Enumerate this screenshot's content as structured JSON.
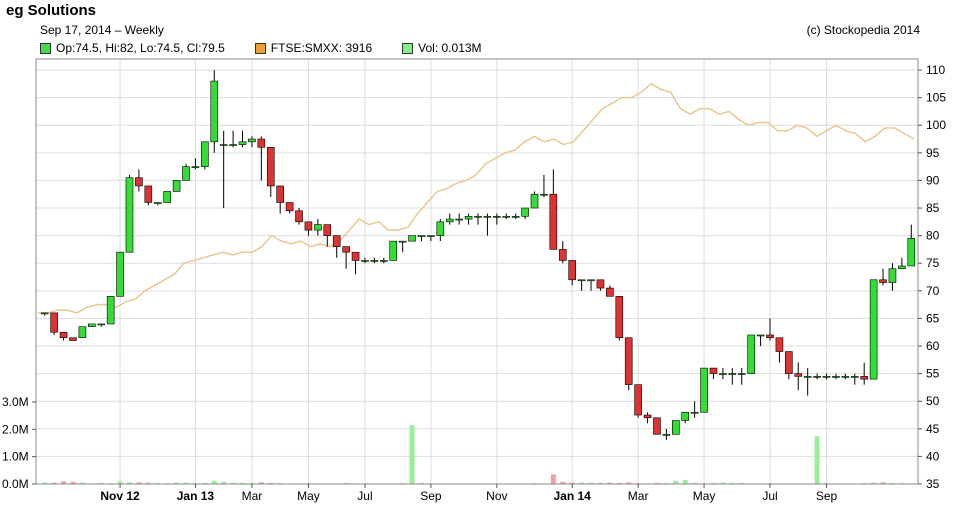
{
  "header": {
    "title": "eg Solutions",
    "subtitle": "Sep 17, 2014  – Weekly",
    "copyright": "(c) Stockopedia 2014"
  },
  "legend": [
    {
      "label": "Op:74.5, Hi:82, Lo:74.5, Cl:79.5",
      "color": "#44dd44"
    },
    {
      "label": "FTSE:SMXX: 3916",
      "color": "#f0a030"
    },
    {
      "label": "Vol: 0.013M",
      "color": "#88ee88"
    }
  ],
  "colors": {
    "up": "#33dd33",
    "down": "#dd3333",
    "index_line": "#e8c890",
    "vol_up": "#99ee99",
    "vol_down": "#f4a0a0",
    "grid": "#dddddd"
  },
  "chart_data": {
    "type": "candlestick",
    "x_ticks": [
      "Nov 12",
      "Jan 13",
      "Mar",
      "May",
      "Jul",
      "Sep",
      "Nov",
      "Jan 14",
      "Mar",
      "May",
      "Jul",
      "Sep"
    ],
    "bold_ticks": [
      "Nov 12",
      "Jan 13",
      "Jan 14"
    ],
    "y_price_ticks": [
      35,
      40,
      45,
      50,
      55,
      60,
      65,
      70,
      75,
      80,
      85,
      90,
      95,
      100,
      105,
      110
    ],
    "y_price_range": [
      35,
      112
    ],
    "y_volume_ticks": [
      "0.0M",
      "1.0M",
      "2.0M",
      "3.0M"
    ],
    "y_volume_range": [
      0,
      3
    ],
    "grid": true,
    "candles": [
      [
        66,
        66,
        65.5,
        66
      ],
      [
        66,
        66,
        62,
        62.5
      ],
      [
        62.5,
        62.5,
        61,
        61.5
      ],
      [
        61.5,
        61.5,
        61,
        61
      ],
      [
        61.5,
        63.5,
        61.5,
        63.5
      ],
      [
        63.5,
        64,
        63.5,
        64
      ],
      [
        64,
        64,
        63.5,
        64
      ],
      [
        64,
        69,
        64,
        69
      ],
      [
        69,
        77,
        69,
        77
      ],
      [
        77,
        91,
        77,
        90.5
      ],
      [
        90.5,
        92,
        88,
        89
      ],
      [
        89,
        89,
        85.5,
        86
      ],
      [
        86,
        86,
        85.5,
        86
      ],
      [
        86,
        88,
        86,
        88
      ],
      [
        88,
        90,
        88,
        90
      ],
      [
        90,
        93,
        90,
        92.5
      ],
      [
        92.5,
        94,
        92,
        92.5
      ],
      [
        92.5,
        97,
        92,
        97
      ],
      [
        97,
        110,
        95,
        108
      ],
      [
        96.5,
        99,
        85,
        96.5
      ],
      [
        96.5,
        99,
        96,
        96.5
      ],
      [
        96.5,
        99,
        96,
        97
      ],
      [
        97,
        98,
        96,
        97.5
      ],
      [
        97.5,
        98,
        90,
        96
      ],
      [
        96,
        96,
        87,
        89
      ],
      [
        89,
        89,
        84,
        86
      ],
      [
        86,
        86,
        84,
        84.5
      ],
      [
        84.5,
        85,
        82,
        82.5
      ],
      [
        82.5,
        82.5,
        80,
        81
      ],
      [
        81,
        83,
        80,
        82
      ],
      [
        82,
        82,
        78,
        80
      ],
      [
        80,
        80,
        76,
        78
      ],
      [
        78,
        78,
        74,
        77
      ],
      [
        77,
        77,
        73,
        75.5
      ],
      [
        75.5,
        76,
        75,
        75.5
      ],
      [
        75.5,
        76,
        75,
        75.5
      ],
      [
        75.5,
        76,
        75,
        75.5
      ],
      [
        75.5,
        79,
        75.5,
        79
      ],
      [
        79,
        79,
        77,
        79
      ],
      [
        79,
        80,
        79,
        80
      ],
      [
        80,
        80,
        79,
        80
      ],
      [
        80,
        80,
        79,
        80
      ],
      [
        80,
        83,
        79,
        82.5
      ],
      [
        82.5,
        84,
        82,
        83
      ],
      [
        83,
        84,
        82,
        83
      ],
      [
        83,
        84,
        82,
        83.5
      ],
      [
        83.5,
        84,
        82,
        83.5
      ],
      [
        83.5,
        84,
        80,
        83.5
      ],
      [
        83.5,
        84,
        82,
        83.5
      ],
      [
        83.5,
        84,
        83,
        83.5
      ],
      [
        83.5,
        84,
        83,
        83.5
      ],
      [
        83.5,
        84,
        83,
        85
      ],
      [
        85,
        88,
        85,
        87.5
      ],
      [
        87.5,
        91,
        87,
        87.5
      ],
      [
        87.5,
        92,
        78,
        77.5
      ],
      [
        77.5,
        79,
        75,
        75.5
      ],
      [
        75.5,
        75.5,
        71,
        72
      ],
      [
        72,
        72,
        70,
        72
      ],
      [
        72,
        72,
        70,
        72
      ],
      [
        72,
        72,
        70,
        70.5
      ],
      [
        70.5,
        71,
        69,
        69
      ],
      [
        69,
        69,
        61,
        61.5
      ],
      [
        61.5,
        61.5,
        52,
        53
      ],
      [
        53,
        53,
        47,
        47.5
      ],
      [
        47.5,
        48,
        46,
        47
      ],
      [
        47,
        47,
        44,
        44
      ],
      [
        44,
        45,
        43,
        44
      ],
      [
        44,
        46,
        44,
        46.5
      ],
      [
        46.5,
        48,
        46,
        48
      ],
      [
        48,
        50,
        47,
        48
      ],
      [
        48,
        56,
        48,
        56
      ],
      [
        56,
        56,
        54,
        55
      ],
      [
        55,
        56,
        54,
        55
      ],
      [
        55,
        56,
        53,
        55
      ],
      [
        55,
        56,
        53,
        55
      ],
      [
        55,
        62,
        55,
        62
      ],
      [
        62,
        62,
        60,
        62
      ],
      [
        62,
        65,
        61,
        61.5
      ],
      [
        61.5,
        61.5,
        57,
        59
      ],
      [
        59,
        59,
        54,
        55
      ],
      [
        55,
        57,
        52,
        54.5
      ],
      [
        54.5,
        56,
        51,
        54.5
      ],
      [
        54.5,
        55,
        54,
        54.5
      ],
      [
        54.5,
        55,
        54,
        54.5
      ],
      [
        54.5,
        55,
        54,
        54.5
      ],
      [
        54.5,
        55,
        54,
        54.5
      ],
      [
        54.5,
        55,
        53,
        54.5
      ],
      [
        54.5,
        57,
        53,
        54
      ],
      [
        54,
        72,
        54,
        72
      ],
      [
        72,
        74,
        71,
        71.5
      ],
      [
        71.5,
        75,
        70,
        74
      ],
      [
        74,
        76,
        74,
        74.5
      ],
      [
        74.5,
        82,
        74.5,
        79.5
      ]
    ],
    "index_series": {
      "name": "FTSE:SMXX",
      "values": [
        66,
        66,
        66.5,
        66.5,
        66,
        67,
        67.5,
        67.5,
        67,
        68,
        68.5,
        70,
        71,
        72,
        73,
        75,
        75.5,
        76,
        76.5,
        77,
        76.5,
        77,
        77,
        78,
        80,
        79,
        78.5,
        79,
        78,
        78.5,
        78,
        79,
        81,
        83,
        82,
        82.5,
        81,
        81,
        81.5,
        84,
        86,
        88,
        88.5,
        89.5,
        90,
        91,
        93,
        94,
        95,
        95.5,
        97,
        98,
        97,
        97.5,
        96.5,
        97,
        99,
        101,
        103,
        104,
        105,
        105,
        106,
        107.5,
        106.5,
        106,
        103,
        102,
        103,
        103,
        102,
        102.5,
        101,
        100,
        100.5,
        100.5,
        99,
        99,
        100,
        99.5,
        98,
        99,
        100,
        99,
        98.5,
        97,
        98,
        99.5,
        99.5,
        98.5,
        97.5
      ],
      "range": [
        35,
        112
      ]
    },
    "volume": {
      "series_values_M": [
        0.05,
        0.05,
        0.1,
        0.08,
        0.05,
        0.02,
        0.04,
        0.03,
        0.1,
        0.06,
        0.06,
        0.05,
        0.03,
        0.03,
        0.05,
        0.05,
        0.03,
        0.04,
        0.12,
        0.08,
        0.05,
        0.04,
        0.04,
        0.06,
        0.04,
        0.03,
        0.02,
        0.02,
        0.03,
        0.02,
        0.02,
        0.02,
        0.03,
        0.02,
        0.02,
        0.02,
        0.02,
        0.02,
        0.03,
        2.15,
        0.04,
        0.03,
        0.02,
        0.02,
        0.02,
        0.02,
        0.02,
        0.02,
        0.02,
        0.02,
        0.02,
        0.02,
        0.03,
        0.02,
        0.35,
        0.08,
        0.05,
        0.05,
        0.04,
        0.04,
        0.05,
        0.04,
        0.06,
        0.03,
        0.02,
        0.04,
        0.03,
        0.12,
        0.15,
        0.04,
        0.02,
        0.03,
        0.05,
        0.03,
        0.04,
        0.02,
        0.02,
        0.03,
        0.02,
        0.02,
        0.02,
        0.02,
        1.75,
        0.03,
        0.02,
        0.02,
        0.02,
        0.03,
        0.05,
        0.06,
        0.04,
        0.03,
        0.013
      ]
    },
    "x_tick_index": [
      8,
      16,
      22,
      28,
      34,
      41,
      48,
      56,
      63,
      70,
      77,
      83
    ]
  }
}
